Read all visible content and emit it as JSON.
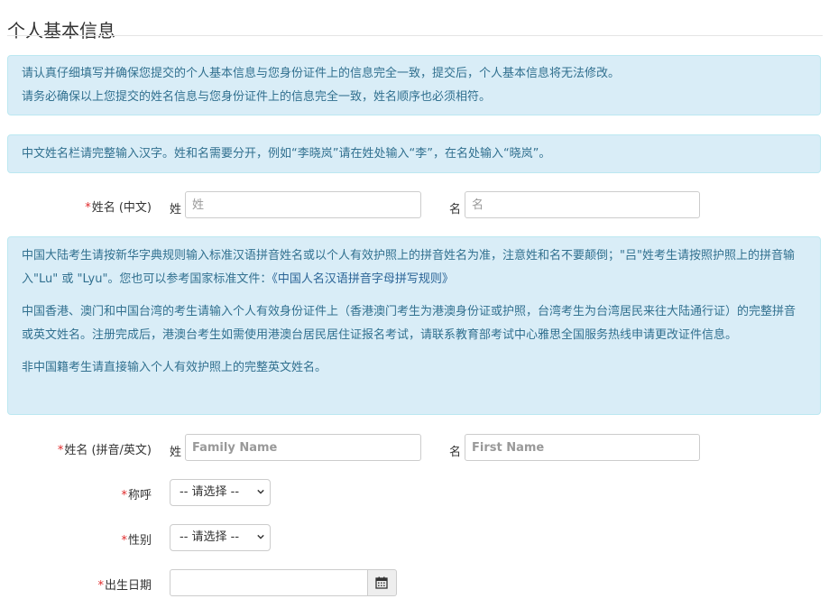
{
  "page": {
    "title": "个人基本信息"
  },
  "notices": {
    "notice1": {
      "line1": "请认真仔细填写并确保您提交的个人基本信息与您身份证件上的信息完全一致，提交后，个人基本信息将无法修改。",
      "line2": "请务必确保以上您提交的姓名信息与您身份证件上的信息完全一致，姓名顺序也必须相符。"
    },
    "notice2": {
      "text": "中文姓名栏请完整输入汉字。姓和名需要分开，例如“李晓岚”请在姓处输入“李”，在名处输入“晓岚”。"
    },
    "notice3": {
      "para1_part1": "中国大陆考生请按新华字典规则输入标准汉语拼音姓名或以个人有效护照上的拼音姓名为准，注意姓和名不要颠倒；\"吕\"姓考生请按照护照上的拼音输入\"Lu\" 或 \"Lyu\"。您也可以参考国家标准文件：",
      "para1_link": "《中国人名汉语拼音字母拼写规则》",
      "para2": "中国香港、澳门和中国台湾的考生请输入个人有效身份证件上（香港澳门考生为港澳身份证或护照，台湾考生为台湾居民来往大陆通行证）的完整拼音或英文姓名。注册完成后，港澳台考生如需使用港澳台居民居住证报名考试，请联系教育部考试中心雅思全国服务热线申请更改证件信息。",
      "para3": "非中国籍考生请直接输入个人有效护照上的完整英文姓名。"
    }
  },
  "form": {
    "required_mark": "*",
    "name_cn": {
      "label": "姓名 (中文)",
      "surname_prefix": "姓",
      "surname_placeholder": "姓",
      "given_prefix": "名",
      "given_placeholder": "名"
    },
    "name_en": {
      "label": "姓名 (拼音/英文)",
      "surname_prefix": "姓",
      "surname_placeholder": "Family Name",
      "given_prefix": "名",
      "given_placeholder": "First Name"
    },
    "salutation": {
      "label": "称呼",
      "selected": "-- 请选择 --"
    },
    "gender": {
      "label": "性别",
      "selected": "-- 请选择 --"
    },
    "birthdate": {
      "label": "出生日期",
      "value": "",
      "icon": "calendar-icon"
    }
  }
}
